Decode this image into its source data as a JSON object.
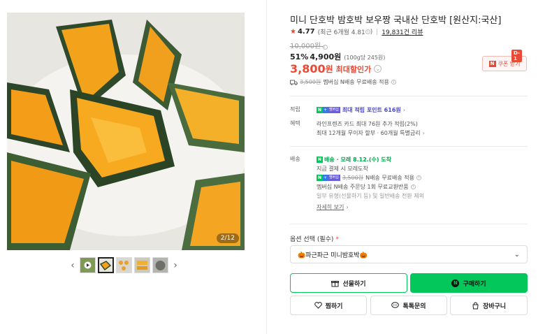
{
  "gallery": {
    "counter": "2/12",
    "prev": "‹",
    "next": "›"
  },
  "product": {
    "title": "미니 단호박 밤호박 보우짱 국내산 단호박 [원산지:국산]",
    "rating": "4.77",
    "rating_detail": "(최근 6개월 4.81",
    "rating_detail_end": ")",
    "review_count": "19,831건 리뷰",
    "original_price": "10,000원",
    "discount_pct": "51%",
    "price": "4,900원",
    "unit_price": "(100g당 245원)",
    "max_discount_price": "3,800",
    "max_discount_won": "원",
    "max_discount_label": "최대할인가",
    "dday": "D-1",
    "coupon_label": "쿠폰 받기",
    "shipping_strike": "3,500원",
    "shipping_text": "멤버십 N배송 무료배송 적용"
  },
  "benefits": {
    "points_label": "적립",
    "points_text": "최대 적립 포인트 616원",
    "card_label": "혜택",
    "card_line1": "라인프렌즈 카드 최대 76원 추가 적립(2%)",
    "card_line2": "최대 12개월 무이자 할부 · 60개월 특별금리"
  },
  "delivery": {
    "label": "배송",
    "tag": "배송",
    "arrival": "· 모레 8.12.(수) 도착",
    "line2": "지금 결제 시 모레도착",
    "line3_strike": "3,500원",
    "line3": "N배송 무료배송 적용",
    "line4": "멤버십 N배송 주문당 1회 무료교환반품",
    "line5": "일부 유형(선물하기 등) 및 일반배송 전환 제외",
    "more": "자세히 보기"
  },
  "option": {
    "label": "옵션 선택 (필수)",
    "required_mark": "*",
    "selected": "🎃파근파근 미니밤호박🎃"
  },
  "buttons": {
    "gift": "선물하기",
    "buy": "구매하기",
    "zzim": "찜하기",
    "talk": "톡톡문의",
    "cart": "장바구니"
  },
  "colors": {
    "accent_green": "#03c75a",
    "discount_red": "#e94a35",
    "point_purple": "#4a47c9"
  }
}
